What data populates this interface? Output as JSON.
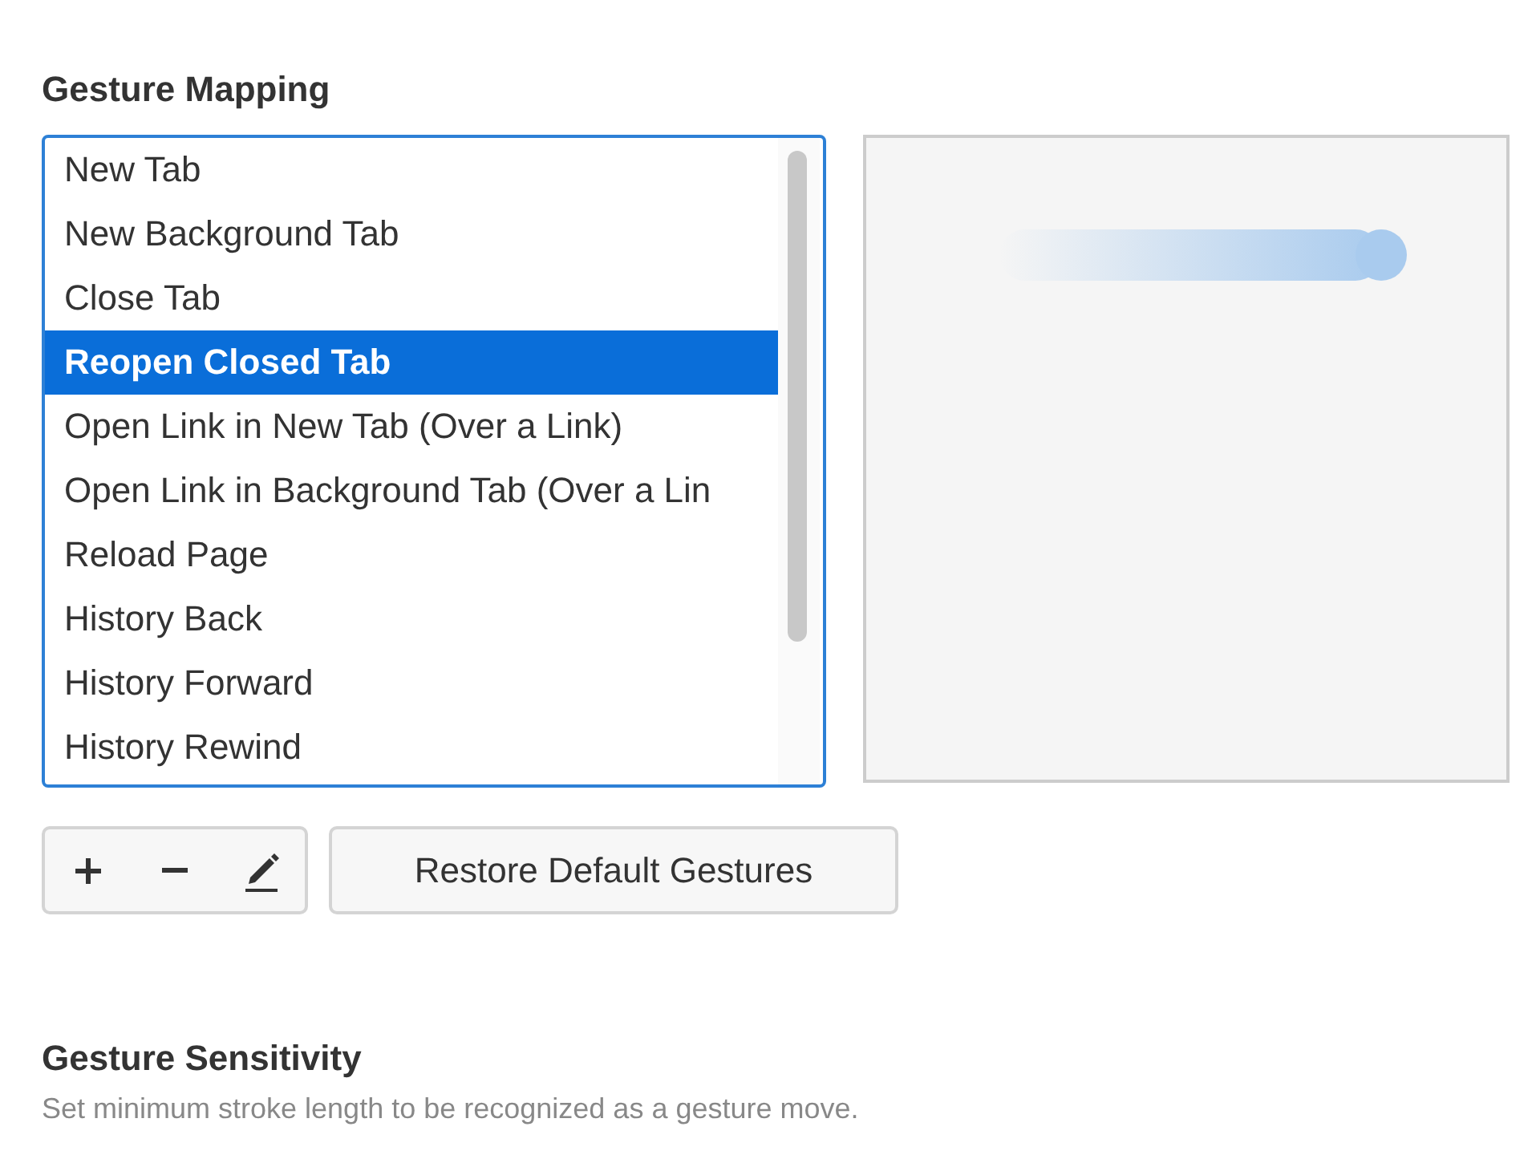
{
  "gesture_mapping": {
    "title": "Gesture Mapping",
    "items": [
      {
        "label": "New Tab",
        "selected": false
      },
      {
        "label": "New Background Tab",
        "selected": false
      },
      {
        "label": "Close Tab",
        "selected": false
      },
      {
        "label": "Reopen Closed Tab",
        "selected": true
      },
      {
        "label": "Open Link in New Tab (Over a Link)",
        "selected": false
      },
      {
        "label": "Open Link in Background Tab (Over a Lin",
        "selected": false
      },
      {
        "label": "Reload Page",
        "selected": false
      },
      {
        "label": "History Back",
        "selected": false
      },
      {
        "label": "History Forward",
        "selected": false
      },
      {
        "label": "History Rewind",
        "selected": false
      }
    ],
    "toolbar": [
      {
        "kind": "add"
      },
      {
        "kind": "remove"
      },
      {
        "kind": "edit"
      }
    ],
    "restore_button": "Restore Default Gestures"
  },
  "gesture_sensitivity": {
    "title": "Gesture Sensitivity",
    "description": "Set minimum stroke length to be recognized as a gesture move."
  }
}
